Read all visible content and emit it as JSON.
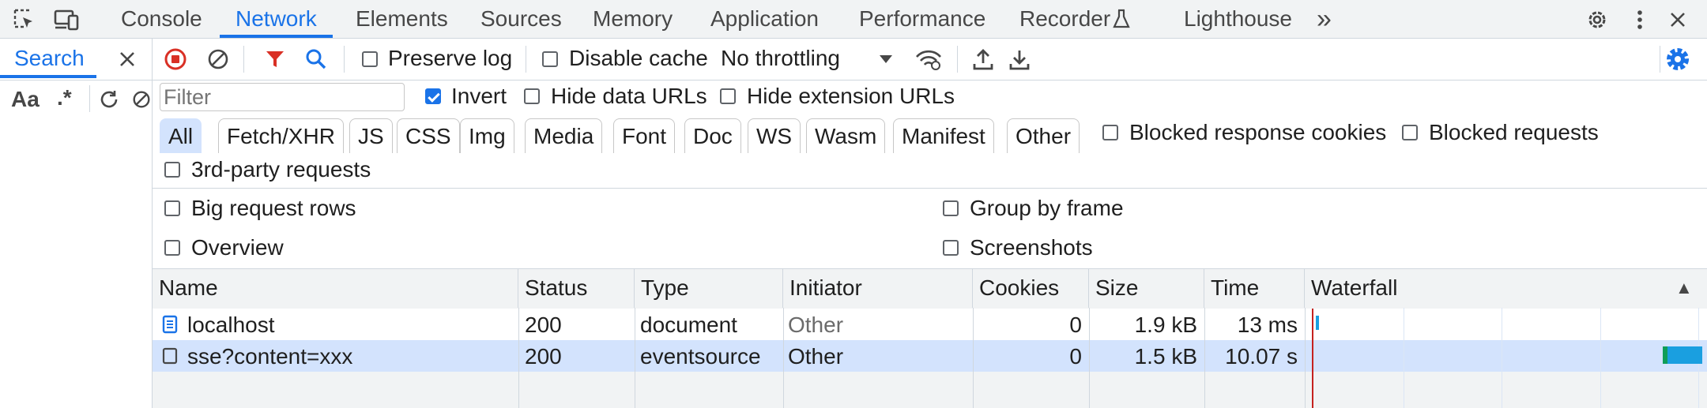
{
  "tabs": {
    "console": "Console",
    "network": "Network",
    "elements": "Elements",
    "sources": "Sources",
    "memory": "Memory",
    "application": "Application",
    "performance": "Performance",
    "recorder": "Recorder",
    "lighthouse": "Lighthouse",
    "more": "»"
  },
  "search_panel": {
    "tab_label": "Search",
    "case_label": "Aa",
    "regex_label": ".*"
  },
  "toolbar": {
    "preserve_log": "Preserve log",
    "disable_cache": "Disable cache",
    "throttling": "No throttling"
  },
  "filter": {
    "placeholder": "Filter",
    "invert": "Invert",
    "hide_data_urls": "Hide data URLs",
    "hide_extension_urls": "Hide extension URLs"
  },
  "type_chips": [
    "All",
    "Fetch/XHR",
    "JS",
    "CSS",
    "Img",
    "Media",
    "Font",
    "Doc",
    "WS",
    "Wasm",
    "Manifest",
    "Other"
  ],
  "extra_filters": {
    "blocked_response_cookies": "Blocked response cookies",
    "blocked_requests": "Blocked requests",
    "third_party": "3rd-party requests"
  },
  "settings": {
    "big_request_rows": "Big request rows",
    "group_by_frame": "Group by frame",
    "overview": "Overview",
    "screenshots": "Screenshots"
  },
  "columns": {
    "name": "Name",
    "status": "Status",
    "type": "Type",
    "initiator": "Initiator",
    "cookies": "Cookies",
    "size": "Size",
    "time": "Time",
    "waterfall": "Waterfall",
    "sort_arrow": "▲"
  },
  "requests": [
    {
      "name": "localhost",
      "status": "200",
      "type": "document",
      "initiator": "Other",
      "cookies": "0",
      "size": "1.9 kB",
      "time": "13 ms"
    },
    {
      "name": "sse?content=xxx",
      "status": "200",
      "type": "eventsource",
      "initiator": "Other",
      "cookies": "0",
      "size": "1.5 kB",
      "time": "10.07 s"
    }
  ],
  "colors": {
    "accent": "#1a73e8",
    "selected_row": "#d3e3fd",
    "record_red": "#d93025",
    "waterfall_bar": "#1a9fe0",
    "waterfall_green": "#0f9d58"
  }
}
